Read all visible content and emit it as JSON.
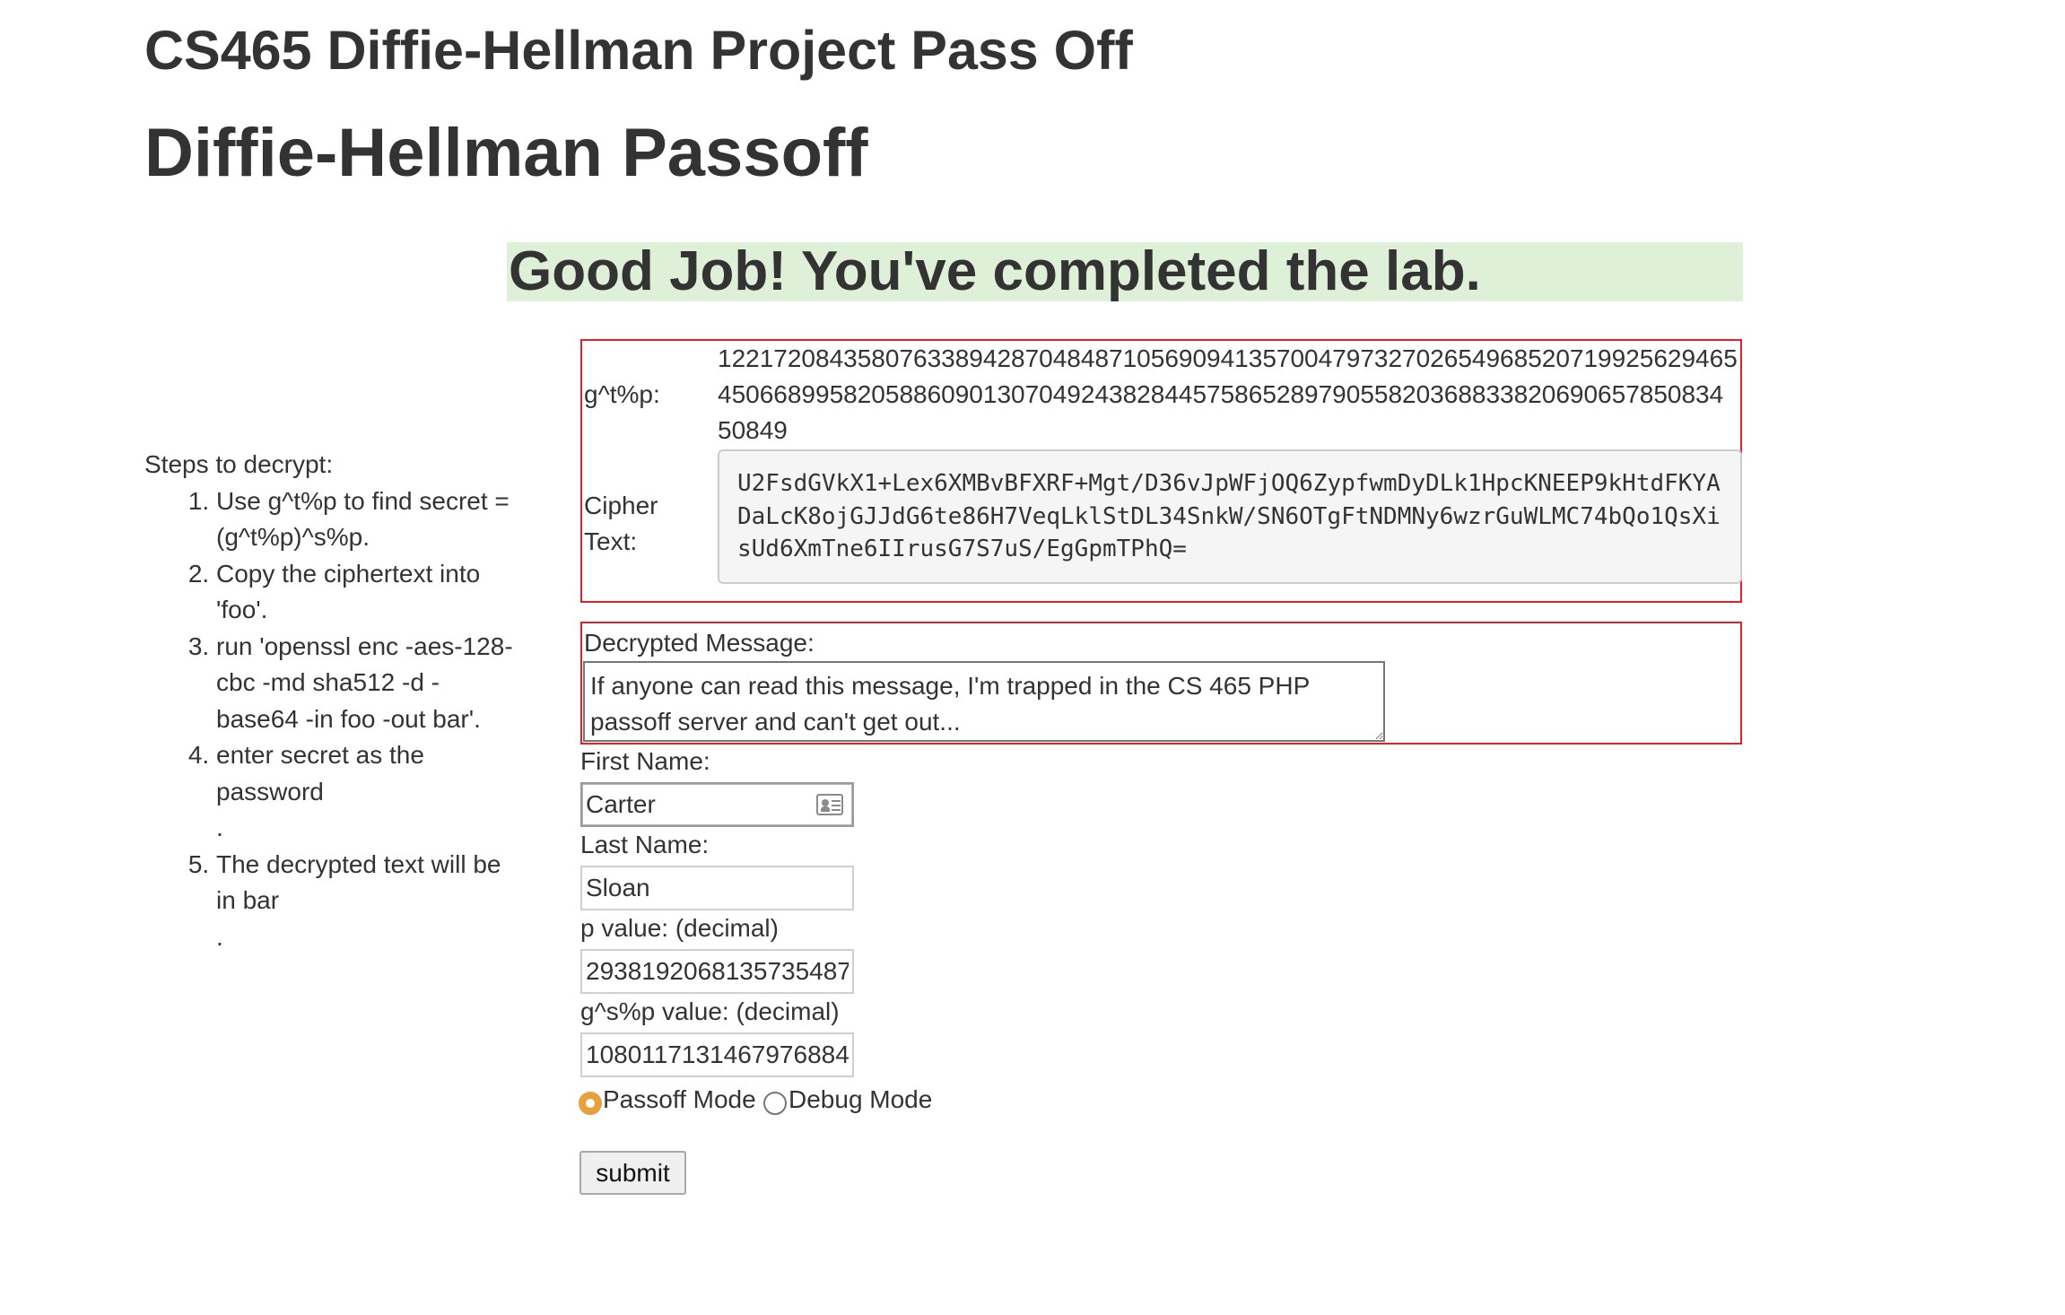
{
  "header": {
    "course_title": "CS465 Diffie-Hellman Project Pass Off",
    "page_title": "Diffie-Hellman Passoff"
  },
  "success_message": "Good Job! You've completed the lab.",
  "instructions": {
    "heading": "Steps to decrypt:",
    "steps": [
      "Use g^t%p to find secret = (g^t%p)^s%p.",
      "Copy the ciphertext into 'foo'.",
      "run 'openssl enc -aes-128-cbc -md sha512 -d -base64 -in foo -out bar'.",
      "enter secret as the password",
      "The decrypted text will be in bar"
    ],
    "step_suffix": "."
  },
  "server_values": {
    "gtp_label": "g^t%p:",
    "gtp_value": "1221720843580763389428704848710569094135700479732702654968520719925629465450668995820588609013070492438284457586528979055820368833820690657850834 50849",
    "cipher_label": "Cipher Text:",
    "cipher_value": "U2FsdGVkX1+Lex6XMBvBFXRF+Mgt/D36vJpWFjOQ6ZypfwmDyDLk1HpcKNEEP9kHtdFKYADaLcK8ojGJJdG6te86H7VeqLklStDL34SnkW/SN6OTgFtNDMNy6wzrGuWLMC74bQo1QsXisUd6XmTne6IIrusG7S7uS/EgGpmTPhQ="
  },
  "decrypted": {
    "label": "Decrypted Message:",
    "value": "If anyone can read this message, I'm trapped in the CS 465 PHP passoff server and can't get out..."
  },
  "form": {
    "first_name_label": "First Name:",
    "first_name_value": "Carter",
    "last_name_label": "Last Name:",
    "last_name_value": "Sloan",
    "p_label": "p value: (decimal)",
    "p_value": "2938192068135735487",
    "gsp_label": "g^s%p value: (decimal)",
    "gsp_value": "1080117131467976884",
    "mode_options": [
      "Passoff Mode",
      "Debug Mode"
    ],
    "selected_mode": "Passoff Mode",
    "submit_label": "submit"
  },
  "icons": {
    "first_name_field": "contact-card-icon",
    "radio_checked": "radio-checked-icon",
    "radio_unchecked": "radio-unchecked-icon"
  },
  "colors": {
    "success_bg": "#dff0d8",
    "error_border": "#e3202a",
    "radio_accent": "#e8a13a",
    "text": "#333333"
  }
}
